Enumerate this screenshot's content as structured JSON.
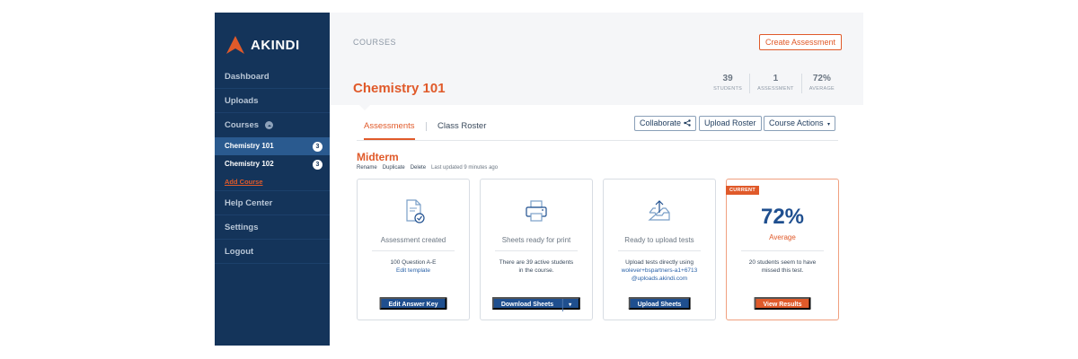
{
  "brand": {
    "name": "AKINDI",
    "accent": "#e05a2a",
    "navy": "#14345a"
  },
  "sidebar": {
    "items": [
      {
        "label": "Dashboard"
      },
      {
        "label": "Uploads"
      }
    ],
    "courses_label": "Courses",
    "courses": [
      {
        "label": "Chemistry 101",
        "count": "3",
        "active": true
      },
      {
        "label": "Chemistry 102",
        "count": "3",
        "active": false
      }
    ],
    "add_course": "Add Course",
    "bottom_items": [
      {
        "label": "Help Center"
      },
      {
        "label": "Settings"
      },
      {
        "label": "Logout"
      }
    ]
  },
  "header": {
    "breadcrumb": "COURSES",
    "create_button": "Create Assessment",
    "course_title": "Chemistry 101",
    "stats": [
      {
        "value": "39",
        "label": "STUDENTS"
      },
      {
        "value": "1",
        "label": "ASSESSMENT"
      },
      {
        "value": "72%",
        "label": "AVERAGE"
      }
    ]
  },
  "tabs": [
    {
      "label": "Assessments",
      "active": true
    },
    {
      "label": "Class Roster",
      "active": false
    }
  ],
  "actions": {
    "collaborate": "Collaborate",
    "upload_roster": "Upload Roster",
    "course_actions": "Course Actions"
  },
  "assessment": {
    "title": "Midterm",
    "links": [
      "Rename",
      "Duplicate",
      "Delete"
    ],
    "last_updated": "Last updated 9 minutes ago"
  },
  "cards": [
    {
      "icon": "document-check-icon",
      "title": "Assessment created",
      "line1": "100 Question A-E",
      "link": "Edit template",
      "button": "Edit Answer Key"
    },
    {
      "icon": "printer-icon",
      "title": "Sheets ready for print",
      "line1": "There are 39 active students",
      "line2": "in the course.",
      "button": "Download Sheets"
    },
    {
      "icon": "upload-tray-icon",
      "title": "Ready to upload tests",
      "line1": "Upload tests directly using",
      "link1": "wolever+bspartners-a1+6713",
      "link2": "@uploads.akindi.com",
      "button": "Upload Sheets"
    },
    {
      "badge": "CURRENT",
      "percent": "72%",
      "percent_label": "Average",
      "line1": "20 students seem to have",
      "line2": "missed this test.",
      "button": "View Results"
    }
  ]
}
